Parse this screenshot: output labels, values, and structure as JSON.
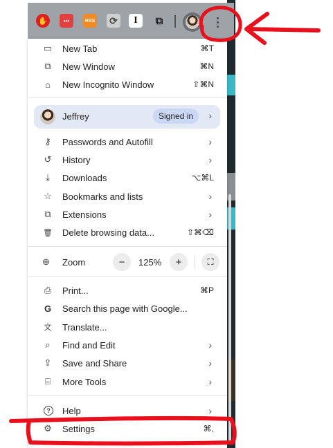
{
  "toolbar": {
    "extensions": [
      {
        "name": "shield-extension-icon",
        "color": "#e02020",
        "glyph": "✋"
      },
      {
        "name": "dots-extension-icon",
        "color": "#e04040",
        "glyph": "•••"
      },
      {
        "name": "rss-extension-icon",
        "color": "#f08a24",
        "glyph": "RSS"
      },
      {
        "name": "sync-extension-icon",
        "color": "#cfcfcf",
        "glyph": "⟳"
      },
      {
        "name": "instapaper-extension-icon",
        "color": "#ffffff",
        "glyph": "I"
      },
      {
        "name": "puzzle-extension-icon",
        "color": "#9ea3a8",
        "glyph": "⧉"
      }
    ]
  },
  "menu": {
    "top_items": [
      {
        "icon": "new-tab-icon",
        "glyph": "▭",
        "label": "New Tab",
        "shortcut": "⌘T"
      },
      {
        "icon": "new-window-icon",
        "glyph": "⧉",
        "label": "New Window",
        "shortcut": "⌘N"
      },
      {
        "icon": "incognito-icon",
        "glyph": "⌂",
        "label": "New Incognito Window",
        "shortcut": "⇧⌘N"
      }
    ],
    "profile": {
      "name": "Jeffrey",
      "status": "Signed in",
      "chevron": "›"
    },
    "account_items": [
      {
        "icon": "key-icon",
        "glyph": "⚷",
        "label": "Passwords and Autofill",
        "chevron": "›"
      },
      {
        "icon": "history-icon",
        "glyph": "↺",
        "label": "History",
        "chevron": "›"
      },
      {
        "icon": "download-icon",
        "glyph": "⤓",
        "label": "Downloads",
        "shortcut": "⌥⌘L"
      },
      {
        "icon": "star-icon",
        "glyph": "☆",
        "label": "Bookmarks and lists",
        "chevron": "›"
      },
      {
        "icon": "extensions-icon",
        "glyph": "⧉",
        "label": "Extensions",
        "chevron": "›"
      },
      {
        "icon": "trash-icon",
        "glyph": "🗑",
        "label": "Delete browsing data...",
        "shortcut": "⇧⌘⌫"
      }
    ],
    "zoom": {
      "label": "Zoom",
      "minus": "−",
      "value": "125%",
      "plus": "+",
      "fullscreen": "⛶"
    },
    "tools_items": [
      {
        "icon": "printer-icon",
        "glyph": "⎙",
        "label": "Print...",
        "shortcut": "⌘P"
      },
      {
        "icon": "google-icon",
        "glyph": "G",
        "label": "Search this page with Google..."
      },
      {
        "icon": "translate-icon",
        "glyph": "文",
        "label": "Translate..."
      },
      {
        "icon": "find-icon",
        "glyph": "⌕",
        "label": "Find and Edit",
        "chevron": "›"
      },
      {
        "icon": "save-share-icon",
        "glyph": "⇪",
        "label": "Save and Share",
        "chevron": "›"
      },
      {
        "icon": "toolbox-icon",
        "glyph": "⌸",
        "label": "More Tools",
        "chevron": "›"
      }
    ],
    "bottom_items": [
      {
        "icon": "help-icon",
        "glyph": "?",
        "label": "Help",
        "chevron": "›"
      },
      {
        "icon": "gear-icon",
        "glyph": "⚙",
        "label": "Settings",
        "shortcut": "⌘,"
      }
    ]
  },
  "annotation_color": "#e8101c"
}
